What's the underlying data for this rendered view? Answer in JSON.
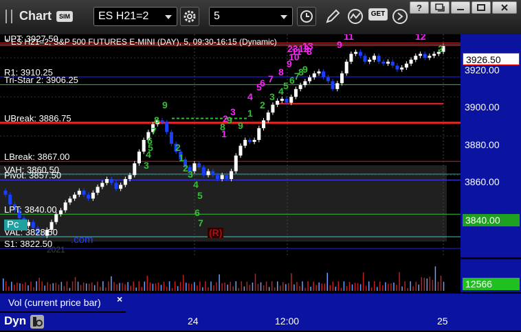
{
  "toolbar": {
    "app_title": "Chart",
    "sim_badge": "SIM",
    "symbol": "ES H21=2",
    "interval": "5",
    "get_label": "GET"
  },
  "chart": {
    "header": "* ES H21=2, S&P 500 FUTURES E-MINI (DAY), 5, 09:30-16:15 (Dynamic)",
    "levels": [
      {
        "label": "UPT: 3927.50",
        "price": 3927.5,
        "color": "#ff3030"
      },
      {
        "label": "R1: 3910.25",
        "price": 3910.25,
        "color": "#2020ff"
      },
      {
        "label": "Tri-Star 2: 3906.25",
        "price": 3906.25,
        "color": "#30c030"
      },
      {
        "label": "UBreak: 3886.75",
        "price": 3886.75,
        "color": "#ff2020"
      },
      {
        "label": "LBreak: 3867.00",
        "price": 3867.0,
        "color": "#d02020"
      },
      {
        "label": "VAH: 3860.50",
        "price": 3860.5,
        "color": "#20b0b0"
      },
      {
        "label": "Pivot: 3857.50",
        "price": 3857.5,
        "color": "#4040ff"
      },
      {
        "label": "LPT: 3840.00",
        "price": 3840.0,
        "color": "#30c030"
      },
      {
        "label": "VAL: 3828.50",
        "price": 3828.5,
        "color": "#30d0c0"
      },
      {
        "label": "S1: 3822.50",
        "price": 3822.5,
        "color": "#2020d0"
      }
    ],
    "extra_texts": [
      "Pc",
      ".com",
      "2021",
      "(R)"
    ],
    "count_labels": {
      "green": [
        "9",
        "8",
        "7",
        "6",
        "5",
        "4",
        "3",
        "2",
        "1",
        "2",
        "3",
        "4",
        "5",
        "6",
        "7",
        "8",
        "9",
        "9",
        "1",
        "2",
        "3",
        "4",
        "5",
        "6",
        "7",
        "8",
        "9",
        "2"
      ],
      "magenta": [
        "1",
        "2",
        "3",
        "4",
        "5",
        "6",
        "7",
        "8",
        "9",
        "10",
        "11",
        "12",
        "13",
        "23",
        "8",
        "9",
        "11",
        "12"
      ]
    }
  },
  "price_axis": {
    "ticks": [
      "3920.00",
      "3900.00",
      "3880.00",
      "3860.00"
    ],
    "last_price": "3926.50",
    "lpt_box": "3840.00"
  },
  "volume": {
    "panel_label": "Vol (current price bar)",
    "close_symbol": "×",
    "current_value": "12566"
  },
  "time_axis": {
    "labels": [
      "24",
      "12:00",
      "25"
    ]
  },
  "footer": {
    "dyn_label": "Dyn"
  },
  "colors": {
    "axis_bg": "#0a14a0",
    "bull": "#ffffff",
    "bear": "#1a40ff",
    "volume_bar": "#c02020",
    "volume_box": "#20c020"
  },
  "chart_data": {
    "type": "candlestick",
    "title": "* ES H21=2, S&P 500 FUTURES E-MINI (DAY), 5, 09:30-16:15 (Dynamic)",
    "ylim": [
      3818,
      3932
    ],
    "close_path": [
      3850,
      3845,
      3842,
      3838,
      3834,
      3836,
      3833,
      3830,
      3829,
      3832,
      3836,
      3840,
      3842,
      3846,
      3848,
      3850,
      3852,
      3850,
      3848,
      3851,
      3854,
      3856,
      3858,
      3856,
      3853,
      3855,
      3858,
      3860,
      3866,
      3872,
      3878,
      3882,
      3886,
      3888,
      3887,
      3882,
      3876,
      3872,
      3868,
      3864,
      3862,
      3866,
      3864,
      3860,
      3862,
      3860,
      3858,
      3860,
      3858,
      3862,
      3870,
      3875,
      3878,
      3877,
      3878,
      3884,
      3888,
      3892,
      3896,
      3898,
      3899,
      3897,
      3900,
      3904,
      3906,
      3908,
      3910,
      3912,
      3913,
      3910,
      3908,
      3904,
      3907,
      3912,
      3918,
      3922,
      3923,
      3921,
      3918,
      3919,
      3921,
      3918,
      3917,
      3918,
      3916,
      3914,
      3915,
      3917,
      3919,
      3921,
      3922,
      3920,
      3921,
      3922,
      3923,
      3926
    ]
  }
}
